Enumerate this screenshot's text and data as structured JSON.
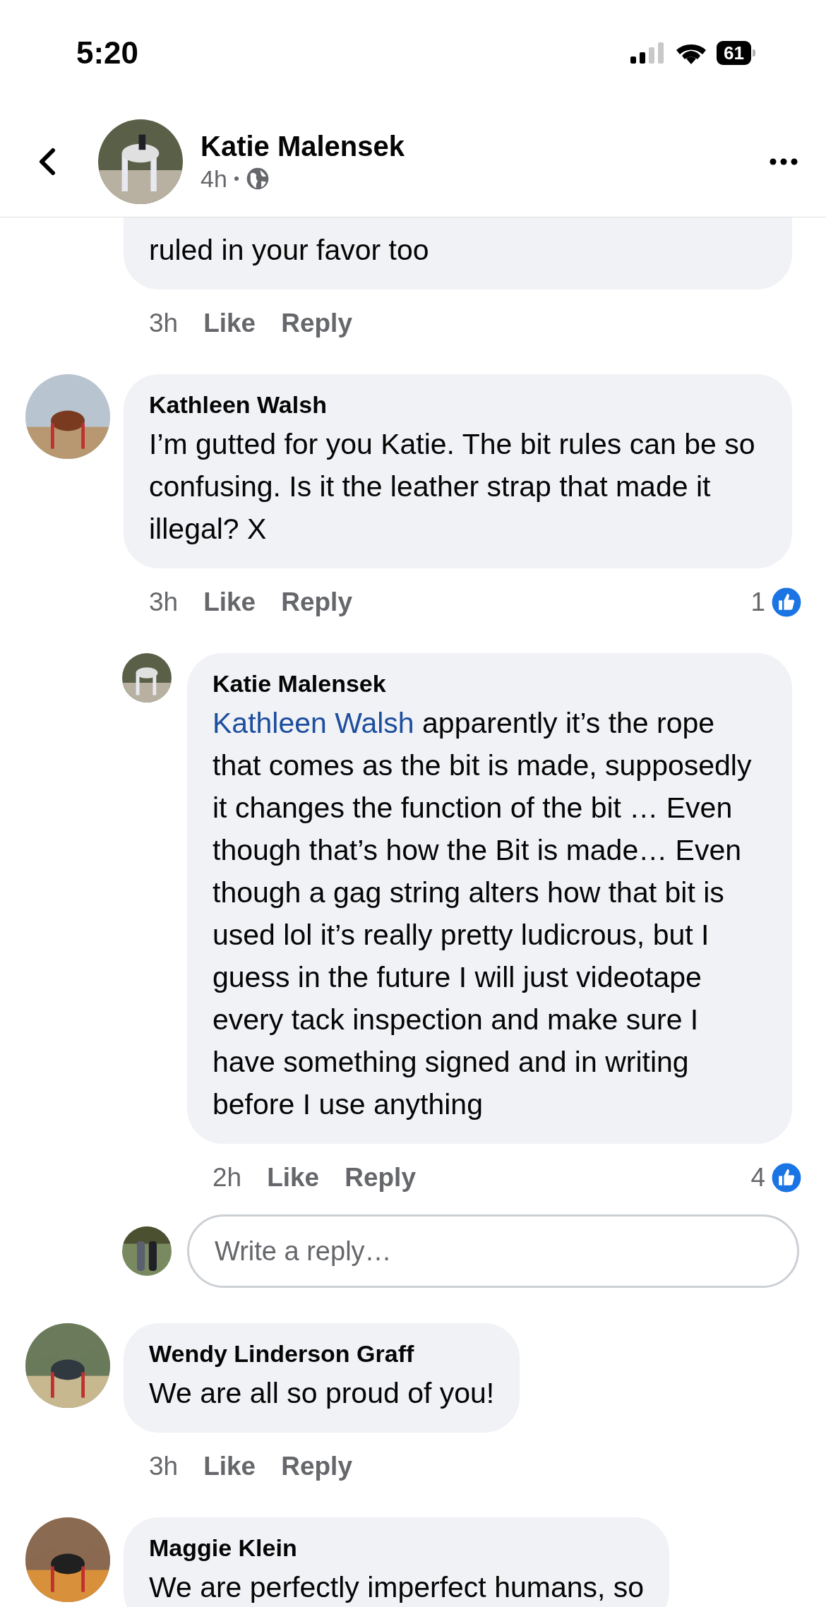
{
  "status_bar": {
    "time": "5:20",
    "battery": "61"
  },
  "header": {
    "author": "Katie Malensek",
    "time": "4h"
  },
  "comments": [
    {
      "kind": "partial",
      "text": "ruled in your favor too",
      "time": "3h",
      "actions": [
        "Like",
        "Reply"
      ]
    },
    {
      "kind": "comment",
      "author": "Kathleen Walsh",
      "text": "I’m gutted for you Katie. The bit rules can be so confusing. Is it the leather strap that made it illegal? X",
      "time": "3h",
      "actions": [
        "Like",
        "Reply"
      ],
      "reactions": "1",
      "replies": [
        {
          "author": "Katie Malensek",
          "mention": "Kathleen Walsh",
          "text": "apparently it’s the rope that comes as the bit is made, supposedly it changes the function of the bit … Even though that’s how the Bit is made… Even though a gag string alters how that bit is used lol it’s really pretty ludicrous, but I guess in the future I will just videotape every tack inspection and make sure I have something signed and in writing before I use anything",
          "time": "2h",
          "actions": [
            "Like",
            "Reply"
          ],
          "reactions": "4"
        }
      ],
      "reply_box": {
        "placeholder": "Write a reply…"
      }
    },
    {
      "kind": "comment",
      "author": "Wendy Linderson Graff",
      "text": "We are all so proud of you!",
      "time": "3h",
      "actions": [
        "Like",
        "Reply"
      ]
    },
    {
      "kind": "comment",
      "author": "Maggie Klein",
      "text": "We are perfectly imperfect humans, so"
    }
  ]
}
